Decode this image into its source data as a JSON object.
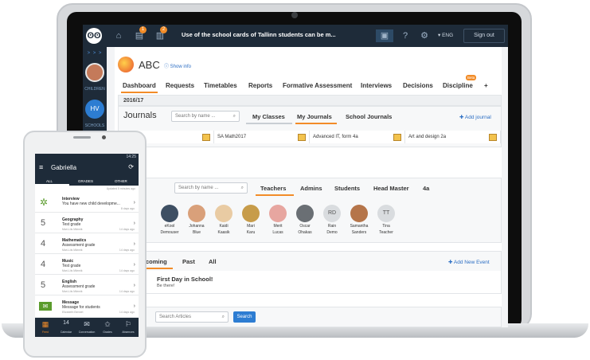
{
  "topbar": {
    "announcement": "Use of the school cards of Tallinn students can be m...",
    "badge_1": "1",
    "badge_2": "2",
    "language": "▾ ENG",
    "sign_out": "Sign out"
  },
  "sidebar": {
    "arrows": "> > >",
    "children_label": "CHILDREN",
    "hv_initials": "HV",
    "schools_label": "SCHOOLS"
  },
  "school": {
    "name": "ABC",
    "show_info": "Show info"
  },
  "nav_tabs": [
    "Dashboard",
    "Requests",
    "Timetables",
    "Reports",
    "Formative Assessment",
    "Interviews",
    "Decisions",
    "Discipline",
    "+"
  ],
  "discipline_badge": "Beta",
  "year": "2016/17",
  "journals": {
    "title": "Journals",
    "search_placeholder": "Search by name ...",
    "tabs": [
      "My Classes",
      "My Journals",
      "School Journals"
    ],
    "add_label": "Add journal",
    "items": [
      "th",
      "SA Math2017",
      "Advanced IT, form 4a",
      "Art and design 2a"
    ]
  },
  "members": {
    "title": "bers",
    "search_placeholder": "Search by name ...",
    "tabs": [
      "Teachers",
      "Admins",
      "Students",
      "Head Master",
      "4a"
    ],
    "people": [
      {
        "first": "eKool",
        "last": "Demouser",
        "initials": ""
      },
      {
        "first": "Johanna",
        "last": "Blue",
        "initials": ""
      },
      {
        "first": "Kaidi",
        "last": "Kaasik",
        "initials": ""
      },
      {
        "first": "Mari",
        "last": "Karu",
        "initials": ""
      },
      {
        "first": "Merit",
        "last": "Lucas",
        "initials": ""
      },
      {
        "first": "Oscar",
        "last": "Ohakas",
        "initials": ""
      },
      {
        "first": "Rain",
        "last": "Demo",
        "initials": "RD"
      },
      {
        "first": "Samantha",
        "last": "Sanders",
        "initials": ""
      },
      {
        "first": "Tina",
        "last": "Teacher",
        "initials": "TT"
      }
    ]
  },
  "events": {
    "title": "s",
    "tabs": [
      "Upcoming",
      "Past",
      "All"
    ],
    "add_label": "Add New Event",
    "year_fragment": "017",
    "first_title": "First Day in School!",
    "first_desc": "Be there!"
  },
  "articles": {
    "search_placeholder": "Search Articles",
    "search_button": "Search"
  },
  "phone": {
    "status_right": "14:25",
    "title": "Gabriella",
    "tabs": [
      "ALL",
      "GRADES",
      "OTHER"
    ],
    "updated": "Updated 5 minutes ago",
    "items": [
      {
        "num": "",
        "title": "Interview",
        "sub": "You have new child developme...",
        "meta": "",
        "date": "8 days ago"
      },
      {
        "num": "5",
        "title": "Geography",
        "sub": "Test grade",
        "meta": "Mari-Liis Männik",
        "date": "14 days ago"
      },
      {
        "num": "4",
        "title": "Mathematics",
        "sub": "Assessment grade",
        "meta": "Mari-Liis Männik",
        "date": "14 days ago"
      },
      {
        "num": "4",
        "title": "Music",
        "sub": "Test grade",
        "meta": "Mari-Liis Männik",
        "date": "14 days ago"
      },
      {
        "num": "5",
        "title": "English",
        "sub": "Assessment grade",
        "meta": "Mari-Liis Männik",
        "date": "14 days ago"
      },
      {
        "num": "",
        "title": "Message",
        "sub": "Message for students",
        "meta": "Elizabeth Bennet",
        "date": "14 days ago"
      }
    ],
    "bottom_nav": [
      "Feed",
      "Calendar",
      "Conversation",
      "Grades",
      "Absences"
    ],
    "calendar_day": "14"
  }
}
